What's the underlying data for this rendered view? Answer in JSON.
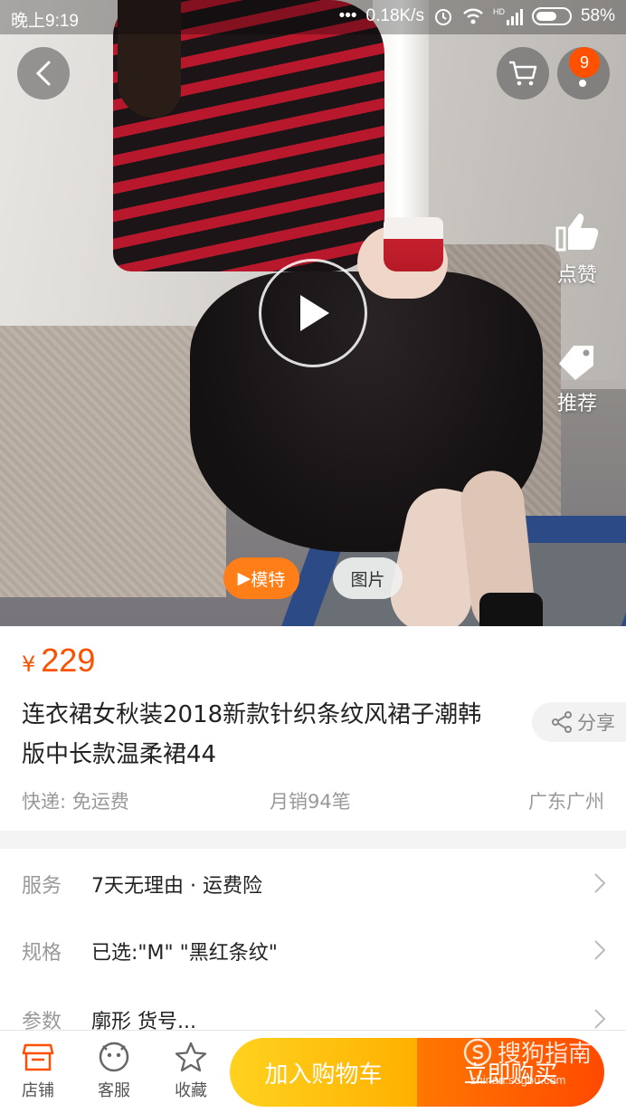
{
  "status_bar": {
    "time": "晚上9:19",
    "dots": "•••",
    "net_speed": "0.18K/s",
    "hd_label": "HD",
    "battery": "58%"
  },
  "nav": {
    "cart_badge": "9",
    "accent": "#ff5000"
  },
  "side_actions": {
    "like": "点赞",
    "recommend": "推荐"
  },
  "media_tabs": {
    "model": "模特",
    "photo": "图片"
  },
  "product": {
    "currency": "¥",
    "price": "229",
    "title": "连衣裙女秋装2018新款针织条纹风裙子潮韩版中长款温柔裙44",
    "share": "分享",
    "shipping": "快递: 免运费",
    "monthly_sales": "月销94笔",
    "location": "广东广州"
  },
  "attributes": [
    {
      "label": "服务",
      "value": "7天无理由 · 运费险"
    },
    {
      "label": "规格",
      "value": "已选:\"M\" \"黑红条纹\""
    },
    {
      "label": "参数",
      "value": "廓形 货号..."
    }
  ],
  "bottom_bar": {
    "shop": "店铺",
    "service": "客服",
    "favorite": "收藏",
    "add_to_cart": "加入购物车",
    "buy_now": "立即购买",
    "cart_color": "#ffc107",
    "buy_color": "#ff5000"
  },
  "watermark": {
    "name": "搜狗指南",
    "url": "zhinan.sogou.com"
  }
}
